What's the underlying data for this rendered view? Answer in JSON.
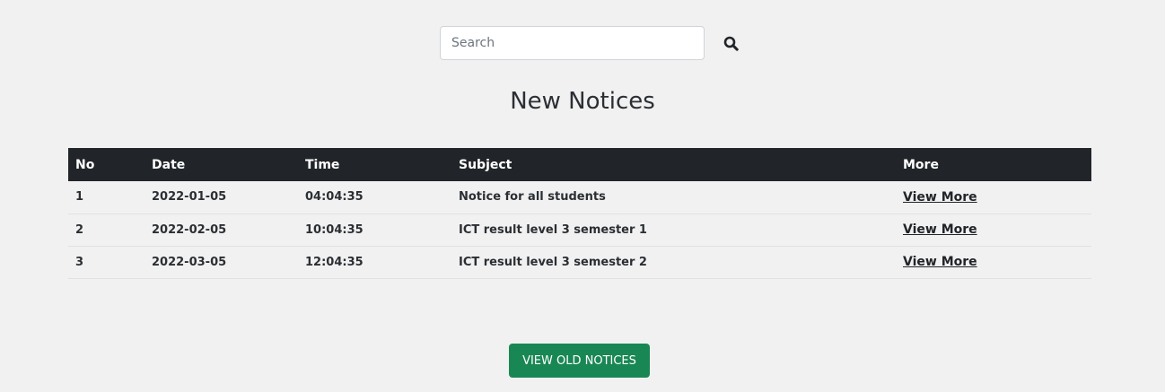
{
  "search": {
    "placeholder": "Search",
    "value": "",
    "button_icon": "search-icon"
  },
  "main": {
    "title": "New Notices",
    "table": {
      "headers": [
        "No",
        "Date",
        "Time",
        "Subject",
        "More"
      ],
      "rows": [
        {
          "no": "1",
          "date": "2022-01-05",
          "time": "04:04:35",
          "subject": "Notice for all students",
          "more": "View More"
        },
        {
          "no": "2",
          "date": "2022-02-05",
          "time": "10:04:35",
          "subject": "ICT result level 3 semester 1",
          "more": "View More"
        },
        {
          "no": "3",
          "date": "2022-03-05",
          "time": "12:04:35",
          "subject": "ICT result level 3 semester 2",
          "more": "View More"
        }
      ]
    },
    "old_notices_label": "VIEW OLD NOTICES"
  },
  "colors": {
    "background": "#f1f1f1",
    "table_header": "#212529",
    "button_green": "#198754"
  }
}
